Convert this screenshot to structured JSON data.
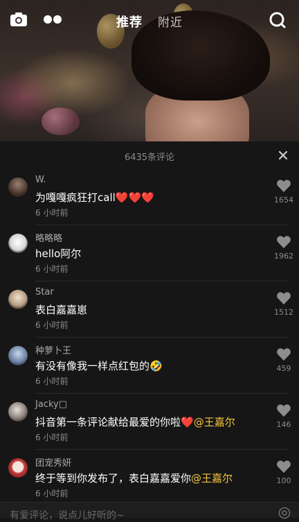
{
  "top_bar": {
    "tab_recommend": "推荐",
    "tab_nearby": "附近"
  },
  "panel": {
    "comment_count": "6435条评论"
  },
  "comments": [
    {
      "user": "W.",
      "text": "为嘎嘎疯狂打call",
      "emoji": "❤️❤️❤️",
      "time": "6 小时前",
      "likes": "1654",
      "avatar_color": "#5a4a40"
    },
    {
      "user": "略略略",
      "text": "hello阿尔",
      "time": "6 小时前",
      "likes": "1962",
      "avatar_color": "#e8e8e8"
    },
    {
      "user": "Star",
      "text": "表白嘉嘉崽",
      "time": "6 小时前",
      "likes": "1512",
      "avatar_color": "#d9c7b2"
    },
    {
      "user": "种萝卜王",
      "text": "有没有像我一样点红包的",
      "emoji": "🤣",
      "time": "6 小时前",
      "likes": "459",
      "avatar_color": "#8fa3bf"
    },
    {
      "user": "Jacky□",
      "text": "抖音第一条评论献给最爱的你啦",
      "emoji": "❤️",
      "mention": "@王嘉尔",
      "time": "6 小时前",
      "likes": "146",
      "avatar_color": "#b7a9a0"
    },
    {
      "user": "团宠秀妍",
      "text": "终于等到你发布了，表白嘉嘉爱你",
      "mention": "@王嘉尔",
      "time": "6 小时前",
      "likes": "100",
      "avatar_color": "#c43a3a"
    }
  ],
  "input": {
    "placeholder": "有爱评论，说点儿好听的~"
  },
  "icons": {
    "camera": "camera-icon",
    "dots": "dots-icon",
    "search": "search-icon",
    "close": "close-icon",
    "heart": "heart-icon",
    "at": "at-icon"
  },
  "colors": {
    "mention": "#f2c541",
    "background": "#161616"
  }
}
